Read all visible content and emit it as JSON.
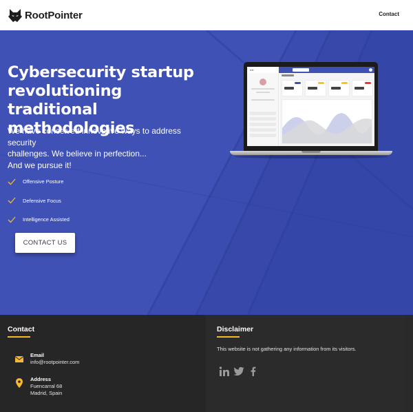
{
  "brand": {
    "name": "RootPointer",
    "logo_icon": "wolf-head-icon"
  },
  "nav": {
    "contact": "Contact"
  },
  "hero": {
    "title": "Cybersecurity startup revolutioning traditional methodologies",
    "subtitle_lines": [
      "We have conceived innovative ways to address security",
      "challenges. We believe in perfection...",
      "And we pursue it!"
    ],
    "features": [
      "Offensive Posture",
      "Defensive Focus",
      "Intelligence Assisted"
    ],
    "cta_label": "CONTACT US",
    "colors": {
      "background": "#3f51b5",
      "check": "#f5b82e"
    },
    "image": "laptop-dashboard-mockup"
  },
  "footer": {
    "contact": {
      "heading": "Contact",
      "email_label": "Email",
      "email_value": "info@rootpointer.com",
      "address_label": "Address",
      "address_line1": "Fuencarral 68",
      "address_line2": "Madrid, Spain"
    },
    "disclaimer": {
      "heading": "Disclaimer",
      "text": "This website is not gathering any information from its visitors."
    },
    "social": [
      "linkedin-icon",
      "twitter-icon",
      "facebook-icon"
    ],
    "colors": {
      "accent": "#f5b82e",
      "background": "#2a2a2a"
    }
  }
}
